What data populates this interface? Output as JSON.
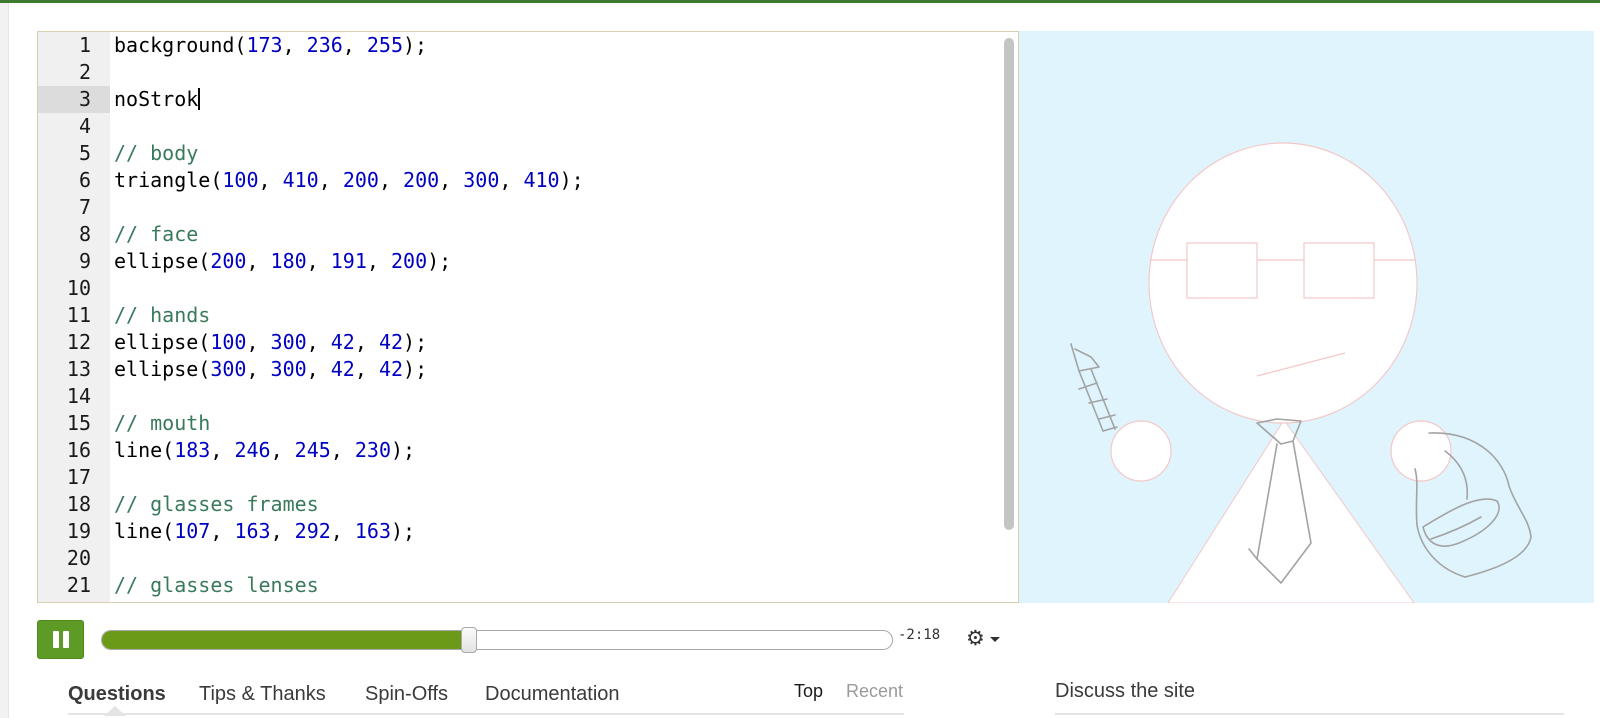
{
  "editor": {
    "active_line": 3,
    "lines": [
      {
        "n": "1",
        "t": [
          {
            "k": "p",
            "v": "background("
          },
          {
            "k": "n",
            "v": "173"
          },
          {
            "k": "p",
            "v": ", "
          },
          {
            "k": "n",
            "v": "236"
          },
          {
            "k": "p",
            "v": ", "
          },
          {
            "k": "n",
            "v": "255"
          },
          {
            "k": "p",
            "v": ");"
          }
        ]
      },
      {
        "n": "2",
        "t": []
      },
      {
        "n": "3",
        "t": [
          {
            "k": "p",
            "v": "noStrok"
          }
        ],
        "caret": true
      },
      {
        "n": "4",
        "t": []
      },
      {
        "n": "5",
        "t": [
          {
            "k": "c",
            "v": "// body"
          }
        ]
      },
      {
        "n": "6",
        "t": [
          {
            "k": "p",
            "v": "triangle("
          },
          {
            "k": "n",
            "v": "100"
          },
          {
            "k": "p",
            "v": ", "
          },
          {
            "k": "n",
            "v": "410"
          },
          {
            "k": "p",
            "v": ", "
          },
          {
            "k": "n",
            "v": "200"
          },
          {
            "k": "p",
            "v": ", "
          },
          {
            "k": "n",
            "v": "200"
          },
          {
            "k": "p",
            "v": ", "
          },
          {
            "k": "n",
            "v": "300"
          },
          {
            "k": "p",
            "v": ", "
          },
          {
            "k": "n",
            "v": "410"
          },
          {
            "k": "p",
            "v": ");"
          }
        ]
      },
      {
        "n": "7",
        "t": []
      },
      {
        "n": "8",
        "t": [
          {
            "k": "c",
            "v": "// face"
          }
        ]
      },
      {
        "n": "9",
        "t": [
          {
            "k": "p",
            "v": "ellipse("
          },
          {
            "k": "n",
            "v": "200"
          },
          {
            "k": "p",
            "v": ", "
          },
          {
            "k": "n",
            "v": "180"
          },
          {
            "k": "p",
            "v": ", "
          },
          {
            "k": "n",
            "v": "191"
          },
          {
            "k": "p",
            "v": ", "
          },
          {
            "k": "n",
            "v": "200"
          },
          {
            "k": "p",
            "v": ");"
          }
        ]
      },
      {
        "n": "10",
        "t": []
      },
      {
        "n": "11",
        "t": [
          {
            "k": "c",
            "v": "// hands"
          }
        ]
      },
      {
        "n": "12",
        "t": [
          {
            "k": "p",
            "v": "ellipse("
          },
          {
            "k": "n",
            "v": "100"
          },
          {
            "k": "p",
            "v": ", "
          },
          {
            "k": "n",
            "v": "300"
          },
          {
            "k": "p",
            "v": ", "
          },
          {
            "k": "n",
            "v": "42"
          },
          {
            "k": "p",
            "v": ", "
          },
          {
            "k": "n",
            "v": "42"
          },
          {
            "k": "p",
            "v": ");"
          }
        ]
      },
      {
        "n": "13",
        "t": [
          {
            "k": "p",
            "v": "ellipse("
          },
          {
            "k": "n",
            "v": "300"
          },
          {
            "k": "p",
            "v": ", "
          },
          {
            "k": "n",
            "v": "300"
          },
          {
            "k": "p",
            "v": ", "
          },
          {
            "k": "n",
            "v": "42"
          },
          {
            "k": "p",
            "v": ", "
          },
          {
            "k": "n",
            "v": "42"
          },
          {
            "k": "p",
            "v": ");"
          }
        ]
      },
      {
        "n": "14",
        "t": []
      },
      {
        "n": "15",
        "t": [
          {
            "k": "c",
            "v": "// mouth"
          }
        ]
      },
      {
        "n": "16",
        "t": [
          {
            "k": "p",
            "v": "line("
          },
          {
            "k": "n",
            "v": "183"
          },
          {
            "k": "p",
            "v": ", "
          },
          {
            "k": "n",
            "v": "246"
          },
          {
            "k": "p",
            "v": ", "
          },
          {
            "k": "n",
            "v": "245"
          },
          {
            "k": "p",
            "v": ", "
          },
          {
            "k": "n",
            "v": "230"
          },
          {
            "k": "p",
            "v": ");"
          }
        ]
      },
      {
        "n": "17",
        "t": []
      },
      {
        "n": "18",
        "t": [
          {
            "k": "c",
            "v": "// glasses frames"
          }
        ]
      },
      {
        "n": "19",
        "t": [
          {
            "k": "p",
            "v": "line("
          },
          {
            "k": "n",
            "v": "107"
          },
          {
            "k": "p",
            "v": ", "
          },
          {
            "k": "n",
            "v": "163"
          },
          {
            "k": "p",
            "v": ", "
          },
          {
            "k": "n",
            "v": "292"
          },
          {
            "k": "p",
            "v": ", "
          },
          {
            "k": "n",
            "v": "163"
          },
          {
            "k": "p",
            "v": ");"
          }
        ]
      },
      {
        "n": "20",
        "t": []
      },
      {
        "n": "21",
        "t": [
          {
            "k": "c",
            "v": "// glasses lenses"
          }
        ]
      }
    ]
  },
  "canvas": {
    "background": "#dff4fc"
  },
  "player": {
    "state": "playing",
    "progress_fraction": 0.465,
    "time_remaining": "-2:18",
    "settings_icon": "gear-icon"
  },
  "tabs": {
    "items": [
      "Questions",
      "Tips & Thanks",
      "Spin-Offs",
      "Documentation"
    ],
    "active": "Questions"
  },
  "sort": {
    "top": "Top",
    "recent": "Recent",
    "active": "Top"
  },
  "discuss": {
    "label": "Discuss the site"
  },
  "colors": {
    "accent_green": "#5e9b26",
    "progress_green": "#6a9a18",
    "number": "#0000c2",
    "comment": "#3a7a5c"
  }
}
